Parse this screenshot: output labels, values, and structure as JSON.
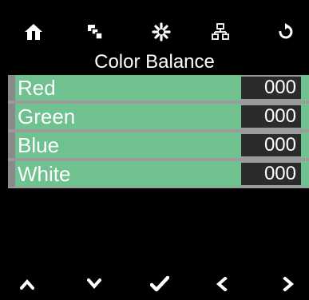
{
  "toolbar": {
    "icons": [
      "home-icon",
      "layers-icon",
      "settings-gear-icon",
      "network-icon",
      "refresh-icon"
    ]
  },
  "screen": {
    "title": "Color Balance"
  },
  "rows": [
    {
      "label": "Red",
      "value": "000"
    },
    {
      "label": "Green",
      "value": "000"
    },
    {
      "label": "Blue",
      "value": "000"
    },
    {
      "label": "White",
      "value": "000"
    }
  ],
  "navigation": {
    "icons": [
      "up-arrow-icon",
      "down-arrow-icon",
      "confirm-check-icon",
      "left-arrow-icon",
      "right-arrow-icon"
    ]
  },
  "colors": {
    "background": "#000000",
    "row_fill": "#6fc190",
    "value_box": "#2b2b2b",
    "frame": "#9b9b9b",
    "text": "#ffffff"
  }
}
